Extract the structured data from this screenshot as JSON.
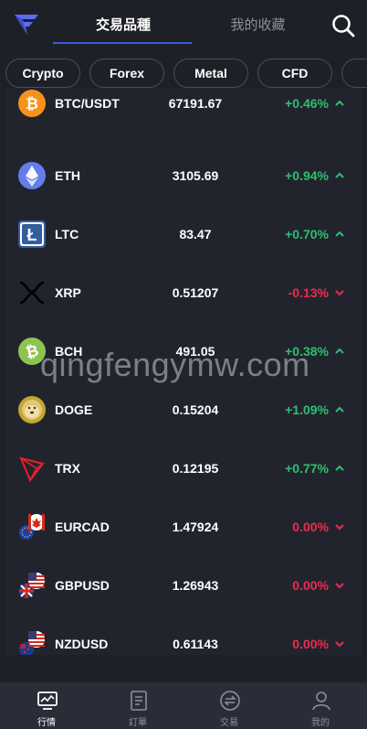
{
  "header": {
    "tabs": [
      {
        "label": "交易品種",
        "active": true
      },
      {
        "label": "我的收藏",
        "active": false
      }
    ]
  },
  "categories": [
    {
      "label": "Crypto"
    },
    {
      "label": "Forex"
    },
    {
      "label": "Metal"
    },
    {
      "label": "CFD"
    },
    {
      "label": ""
    }
  ],
  "rows": [
    {
      "symbol": "BTC/USDT",
      "price": "67191.67",
      "change": "+0.46%",
      "direction": "up",
      "icon": "bitcoin-icon"
    },
    {
      "symbol": "ETH",
      "price": "3105.69",
      "change": "+0.94%",
      "direction": "up",
      "icon": "ethereum-icon"
    },
    {
      "symbol": "LTC",
      "price": "83.47",
      "change": "+0.70%",
      "direction": "up",
      "icon": "litecoin-icon"
    },
    {
      "symbol": "XRP",
      "price": "0.51207",
      "change": "-0.13%",
      "direction": "down",
      "icon": "xrp-icon"
    },
    {
      "symbol": "BCH",
      "price": "491.05",
      "change": "+0.38%",
      "direction": "up",
      "icon": "bitcoin-cash-icon"
    },
    {
      "symbol": "DOGE",
      "price": "0.15204",
      "change": "+1.09%",
      "direction": "up",
      "icon": "dogecoin-icon"
    },
    {
      "symbol": "TRX",
      "price": "0.12195",
      "change": "+0.77%",
      "direction": "up",
      "icon": "tron-icon"
    },
    {
      "symbol": "EURCAD",
      "price": "1.47924",
      "change": "0.00%",
      "direction": "down",
      "icon": "eur-cad-flags-icon"
    },
    {
      "symbol": "GBPUSD",
      "price": "1.26943",
      "change": "0.00%",
      "direction": "down",
      "icon": "gbp-usd-flags-icon"
    },
    {
      "symbol": "NZDUSD",
      "price": "0.61143",
      "change": "0.00%",
      "direction": "down",
      "icon": "nzd-usd-flags-icon"
    }
  ],
  "watermark": "qingfengymw.com",
  "bottom_nav": [
    {
      "label": "行情",
      "icon": "chart-monitor-icon",
      "active": true
    },
    {
      "label": "訂單",
      "icon": "document-icon",
      "active": false
    },
    {
      "label": "交易",
      "icon": "exchange-icon",
      "active": false
    },
    {
      "label": "我的",
      "icon": "user-icon",
      "active": false
    }
  ],
  "colors": {
    "background": "#1e2028",
    "list_background": "#22242d",
    "accent": "#3f5bd8",
    "up": "#2fbf71",
    "down": "#ec2b4f",
    "bottom_bar": "#2a2c38"
  }
}
